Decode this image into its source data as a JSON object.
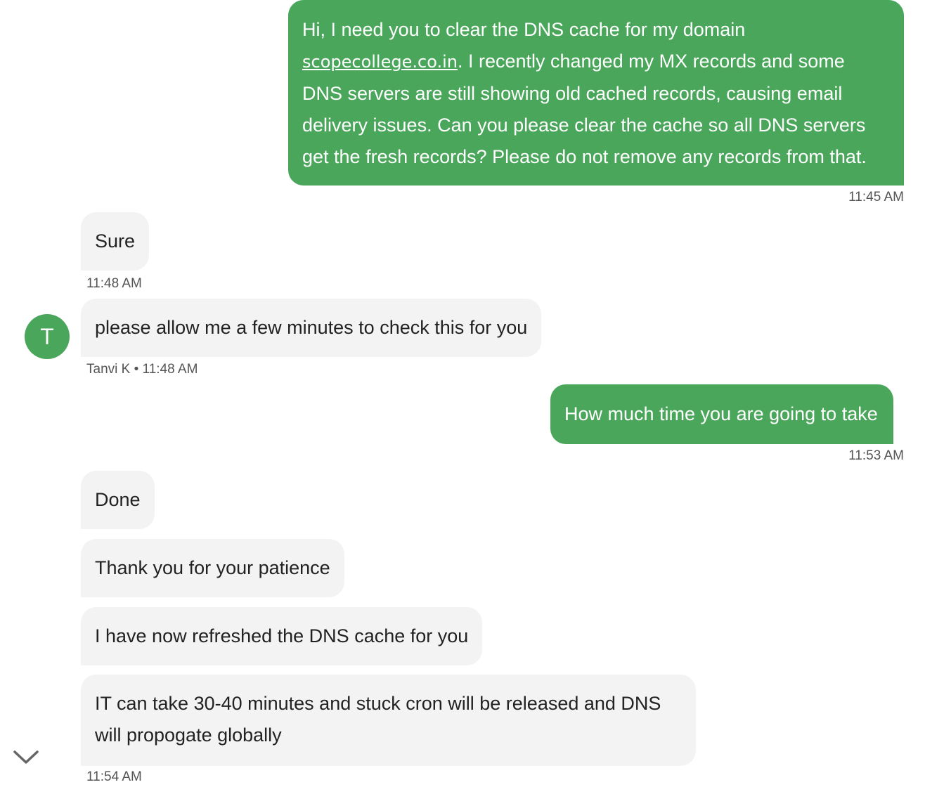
{
  "messages": {
    "m1": {
      "text_before": "Hi, I need you to clear the DNS cache for my domain ",
      "link": "scopecollege.co.in",
      "text_after": ". I recently changed my MX records and some DNS servers are still showing old cached records, causing email delivery issues. Can you please clear the cache so all DNS servers get the fresh records? Please do not remove any records from that.",
      "time": "11:45 AM"
    },
    "m2": {
      "text": "Sure",
      "time": "11:48 AM"
    },
    "m3": {
      "text": "please allow me a few minutes to check this for you",
      "sender": "Tanvi K",
      "separator": "•",
      "time": "11:48 AM"
    },
    "m4": {
      "text": "How much time you are going to take",
      "time": "11:53 AM"
    },
    "m5": {
      "text": "Done"
    },
    "m6": {
      "text": "Thank you for your patience"
    },
    "m7": {
      "text": "I have now refreshed the DNS cache for you"
    },
    "m8": {
      "text": "IT can take 30-40 minutes and stuck cron will be released and DNS will propogate globally",
      "time": "11:54 AM"
    }
  },
  "agent": {
    "avatar_letter": "T"
  },
  "icons": {
    "scroll_down": "chevron-down-icon"
  },
  "colors": {
    "outgoing": "#4aa65b",
    "incoming": "#f3f3f3",
    "avatar": "#4aa65b"
  }
}
